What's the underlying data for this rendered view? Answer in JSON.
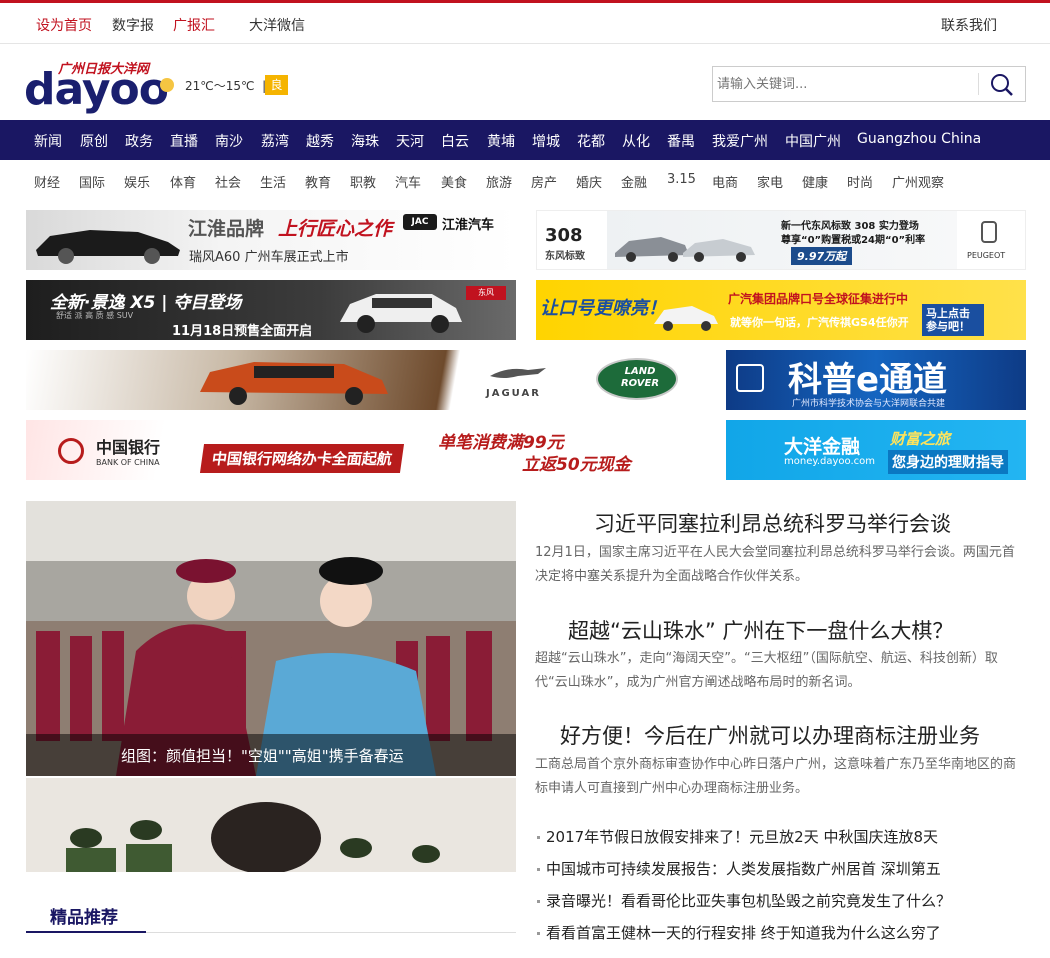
{
  "topbar": {
    "set_home": "设为首页",
    "digital_paper": "数字报",
    "ad_collection": "广报汇",
    "dayoo_wechat": "大洋微信",
    "contact": "联系我们"
  },
  "header": {
    "logo_sub": "广州日报大洋网",
    "logo_main": "dayoo",
    "weather": "21℃～15℃",
    "aqi": "良",
    "search_placeholder": "请输入关键词..."
  },
  "main_nav": [
    "新闻",
    "原创",
    "政务",
    "直播",
    "南沙",
    "荔湾",
    "越秀",
    "海珠",
    "天河",
    "白云",
    "黄埔",
    "增城",
    "花都",
    "从化",
    "番禺",
    "我爱广州",
    "中国广州",
    "Guangzhou China"
  ],
  "sub_nav": [
    "财经",
    "国际",
    "娱乐",
    "体育",
    "社会",
    "生活",
    "教育",
    "职教",
    "汽车",
    "美食",
    "旅游",
    "房产",
    "婚庆",
    "金融",
    "3.15",
    "电商",
    "家电",
    "健康",
    "时尚",
    "广州观察"
  ],
  "ads": {
    "jac_title": "江淮品牌",
    "jac_slogan": "上行匠心之作",
    "jac_sub": "瑞风A60 广州车展正式上市",
    "jac_brand": "江淮汽车",
    "peugeot_model": "308",
    "peugeot_brand_cn": "东风标致",
    "peugeot_text1": "新一代东风标致 308 实力登场",
    "peugeot_text2": "尊享“0”购置税或24期“0”利率",
    "peugeot_price": "9.97万起",
    "peugeot_logo": "PEUGEOT",
    "dongfeng_title": "全新·景逸 X5 | 夺目登场",
    "dongfeng_sub": "舒适 派 高 质 感 SUV",
    "dongfeng_date": "11月18日预售全面开启",
    "gac_left": "让口号更嘹亮！",
    "gac_title": "广汽集团品牌口号全球征集进行中",
    "gac_sub": "就等你一句话，广汽传祺GS4任你开",
    "gac_btn": "马上点击参与吧！",
    "jaguar": "JAGUAR",
    "landrover": "LAND ROVER",
    "science_title": "科普e通道",
    "science_sub": "广州市科学技术协会与大洋网联合共建",
    "boc_name": "中国银行",
    "boc_en": "BANK OF CHINA",
    "boc_slogan": "中国银行网络办卡全面起航",
    "boc_promo1": "单笔消费满99元",
    "boc_promo2": "立返50元现金",
    "finance_title": "大洋金融",
    "finance_url": "money.dayoo.com",
    "finance_tag": "财富之旅",
    "finance_sub": "您身边的理财指导"
  },
  "feature": {
    "caption": "组图：颜值担当！\"空姐\"\"高姐\"携手备春运"
  },
  "section": {
    "title": "精品推荐"
  },
  "headlines": [
    {
      "title": "习近平同塞拉利昂总统科罗马举行会谈",
      "summary": "12月1日，国家主席习近平在人民大会堂同塞拉利昂总统科罗马举行会谈。两国元首决定将中塞关系提升为全面战略合作伙伴关系。"
    },
    {
      "title": "超越“云山珠水” 广州在下一盘什么大棋？",
      "summary": "超越“云山珠水”，走向“海阔天空”。“三大枢纽”（国际航空、航运、科技创新）取代“云山珠水”，成为广州官方阐述战略布局时的新名词。"
    },
    {
      "title": "好方便！今后在广州就可以办理商标注册业务",
      "summary": "工商总局首个京外商标审查协作中心昨日落户广州，这意味着广东乃至华南地区的商标申请人可直接到广州中心办理商标注册业务。"
    }
  ],
  "news_list": [
    "2017年节假日放假安排来了！元旦放2天 中秋国庆连放8天",
    "中国城市可持续发展报告：人类发展指数广州居首 深圳第五",
    "录音曝光！看看哥伦比亚失事包机坠毁之前究竟发生了什么？",
    "看看首富王健林一天的行程安排 终于知道我为什么这么穷了"
  ]
}
